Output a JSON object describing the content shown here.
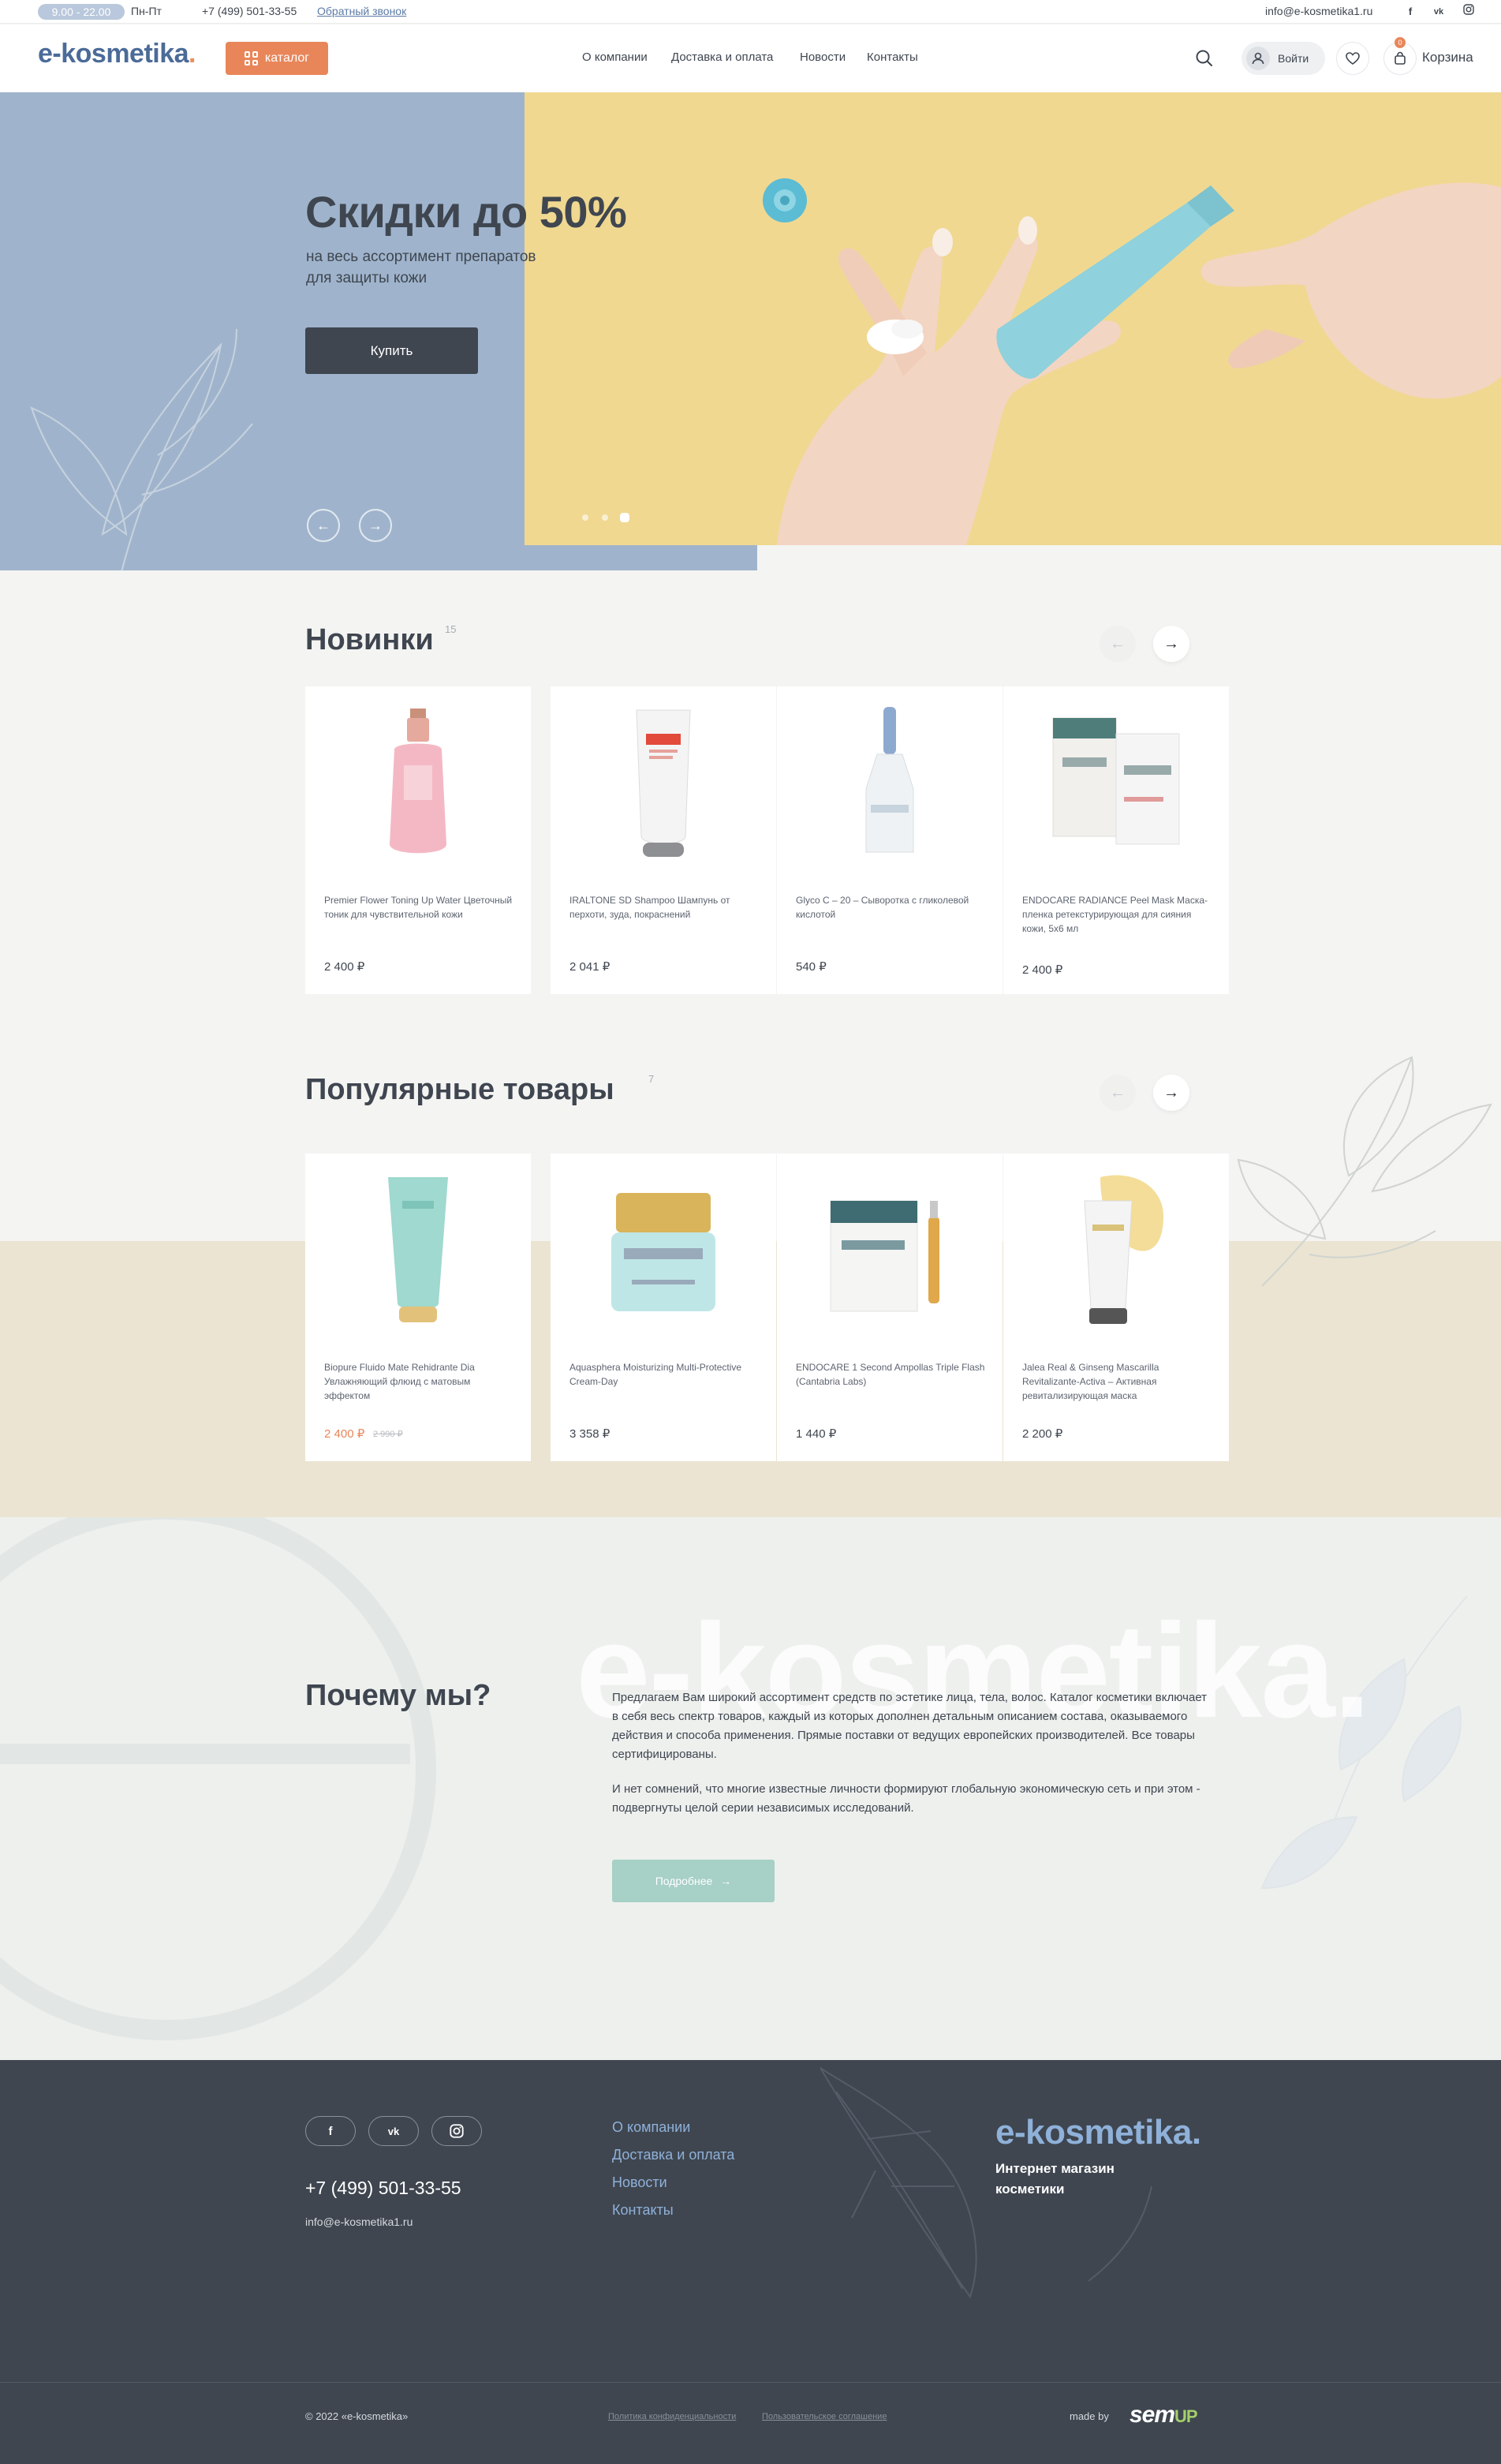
{
  "topbar": {
    "hours": "9.00 - 22.00",
    "days": "Пн-Пт",
    "phone": "+7 (499) 501-33-55",
    "callback": "Обратный звонок",
    "email": "info@e-kosmetika1.ru",
    "social": [
      "f",
      "vk",
      "ig"
    ]
  },
  "header": {
    "logo": "e-kosmetika",
    "catalog": "каталог",
    "nav": [
      "О компании",
      "Доставка и оплата",
      "Новости",
      "Контакты"
    ],
    "login": "Войти",
    "cart_count": "0",
    "cart": "Корзина"
  },
  "hero": {
    "title": "Скидки до 50%",
    "subtitle": "на весь ассортимент препаратов для защиты кожи",
    "button": "Купить",
    "slide_count": 3,
    "active_slide": 3
  },
  "new_items": {
    "title": "Новинки",
    "count": "15",
    "products": [
      {
        "name": "Premier Flower Toning Up Water Цветочный тоник для чувствительной кожи",
        "price": "2 400 ₽"
      },
      {
        "name": "IRALTONE SD Shampoo Шампунь от перхоти, зуда, покраснений",
        "price": "2 041 ₽"
      },
      {
        "name": "Glyco C – 20 – Сыворотка с гликолевой кислотой",
        "price": "540 ₽"
      },
      {
        "name": "ENDOCARE RADIANCE Peel Mask Маска-пленка ретекстурирующая для сияния кожи, 5x6 мл",
        "price": "2 400 ₽"
      }
    ]
  },
  "popular": {
    "title": "Популярные товары",
    "count": "7",
    "products": [
      {
        "name": "Biopure Fluido Mate Rehidrante Dia Увлажняющий флюид с матовым эффектом",
        "price": "2 400 ₽",
        "old_price": "2 990 ₽"
      },
      {
        "name": "Aquasphera Moisturizing Multi-Protective Cream-Day",
        "price": "3 358 ₽"
      },
      {
        "name": "ENDOCARE 1 Second Ampollas Triple Flash (Cantabria Labs)",
        "price": "1 440 ₽"
      },
      {
        "name": "Jalea Real & Ginseng Mascarilla Revitalizante-Activa – Активная ревитализирующая маска",
        "price": "2 200 ₽"
      }
    ]
  },
  "why": {
    "watermark": "e-kosmetika.",
    "title": "Почему мы?",
    "p1": "Предлагаем Вам широкий ассортимент средств по эстетике лица, тела, волос. Каталог косметики включает в себя весь спектр товаров, каждый из которых дополнен детальным описанием состава, оказываемого действия и способа применения. Прямые поставки от ведущих европейских производителей. Все товары сертифицированы.",
    "p2": "И нет сомнений, что многие известные личности формируют глобальную экономическую сеть и при этом - подвергнуты целой серии независимых исследований.",
    "button": "Подробнее"
  },
  "footer": {
    "social": [
      "f",
      "vk",
      "ig"
    ],
    "phone": "+7 (499) 501-33-55",
    "email": "info@e-kosmetika1.ru",
    "links": [
      "О компании",
      "Доставка и оплата",
      "Новости",
      "Контакты"
    ],
    "logo": "e-kosmetika",
    "tagline": "Интернет магазин косметики",
    "copyright": "© 2022 «e-kosmetika»",
    "privacy": "Политика конфиденциальности",
    "terms": "Пользовательское соглашение",
    "made_by": "made by",
    "dev_name": "sem",
    "dev_name_accent": "UP"
  },
  "colors": {
    "accent": "#e8865a",
    "brand_blue": "#4b6b98",
    "dark": "#3f4650",
    "hero_blue": "#9fb4cc",
    "hero_yellow": "#f0d891",
    "mint": "#a7d0c6"
  }
}
